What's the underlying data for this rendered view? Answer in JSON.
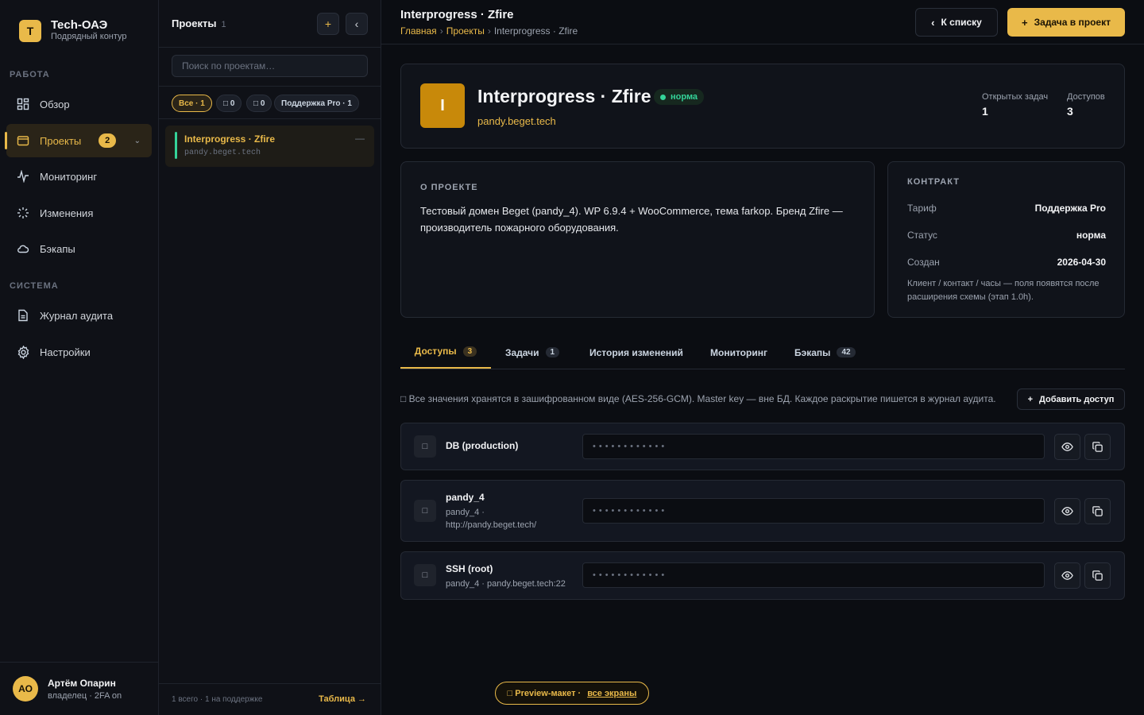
{
  "brand": {
    "logo_letter": "T",
    "name": "Tech-ОАЭ",
    "subtitle": "Подрядный контур"
  },
  "nav": {
    "section_work": "РАБОТА",
    "section_system": "СИСТЕМА",
    "items": [
      {
        "label": "Обзор",
        "icon": "grid-icon"
      },
      {
        "label": "Проекты",
        "icon": "folder-icon",
        "badge": "2",
        "active": true
      },
      {
        "label": "Мониторинг",
        "icon": "activity-icon"
      },
      {
        "label": "Изменения",
        "icon": "loader-icon"
      },
      {
        "label": "Бэкапы",
        "icon": "cloud-icon"
      },
      {
        "label": "Журнал аудита",
        "icon": "file-text-icon"
      },
      {
        "label": "Настройки",
        "icon": "gear-icon"
      }
    ]
  },
  "user": {
    "initials": "АО",
    "name": "Артём Опарин",
    "role": "владелец · 2FA on"
  },
  "projects_panel": {
    "title": "Проекты",
    "count": "1",
    "add_label": "+",
    "collapse_label": "‹",
    "search_placeholder": "Поиск по проектам…",
    "filters": [
      {
        "label": "Все · 1",
        "active": true
      },
      {
        "label": "□ 0"
      },
      {
        "label": "□ 0"
      },
      {
        "label": "Поддержка Pro · 1"
      }
    ],
    "items": [
      {
        "name": "Interprogress · Zfire",
        "domain": "pandy.beget.tech",
        "status_color": "#34d399",
        "menu": "—"
      }
    ],
    "footer_summary": "1 всего · 1 на поддержке",
    "footer_link": "Таблица →"
  },
  "header": {
    "title": "Interprogress · Zfire",
    "breadcrumbs": [
      "Главная",
      "Проекты",
      "Interprogress · Zfire"
    ],
    "back_label": "К списку",
    "primary_label": "Задача в проект"
  },
  "project": {
    "logo_letter": "I",
    "name": "Interprogress · Zfire",
    "status": "норма",
    "domain": "pandy.beget.tech",
    "stats": [
      {
        "label": "Открытых задач",
        "value": "1"
      },
      {
        "label": "Доступов",
        "value": "3"
      }
    ]
  },
  "about": {
    "heading": "О ПРОЕКТЕ",
    "text": "Тестовый домен Beget (pandy_4). WP 6.9.4 + WooCommerce, тема farkop. Бренд Zfire — производитель пожарного оборудования."
  },
  "contract": {
    "heading": "КОНТРАКТ",
    "rows": [
      {
        "key": "Тариф",
        "value": "Поддержка Pro"
      },
      {
        "key": "Статус",
        "value": "норма"
      },
      {
        "key": "Создан",
        "value": "2026-04-30"
      }
    ],
    "note": "Клиент / контакт / часы — поля появятся после расширения схемы (этап 1.0h)."
  },
  "tabs": [
    {
      "label": "Доступы",
      "count": "3",
      "active": true
    },
    {
      "label": "Задачи",
      "count": "1"
    },
    {
      "label": "История изменений"
    },
    {
      "label": "Мониторинг"
    },
    {
      "label": "Бэкапы",
      "count": "42"
    }
  ],
  "access": {
    "note": "□ Все значения хранятся в зашифрованном виде (AES-256-GCM). Master key — вне БД. Каждое раскрытие пишется в журнал аудита.",
    "add_label": "Добавить доступ",
    "items": [
      {
        "icon_glyph": "□",
        "title": "DB (production)",
        "sub": "",
        "masked": "••••••••••••"
      },
      {
        "icon_glyph": "□",
        "title": "pandy_4",
        "sub": "pandy_4 ·",
        "sub2": "http://pandy.beget.tech/",
        "masked": "••••••••••••"
      },
      {
        "icon_glyph": "□",
        "title": "SSH (root)",
        "sub": "pandy_4 · pandy.beget.tech:22",
        "masked": "••••••••••••"
      }
    ]
  },
  "preview": {
    "label": "□ Preview-макет ·",
    "link": "все экраны"
  },
  "colors": {
    "accent": "#e9b949",
    "success": "#34d399",
    "background": "#0b0d12",
    "panel": "#0f1117"
  }
}
